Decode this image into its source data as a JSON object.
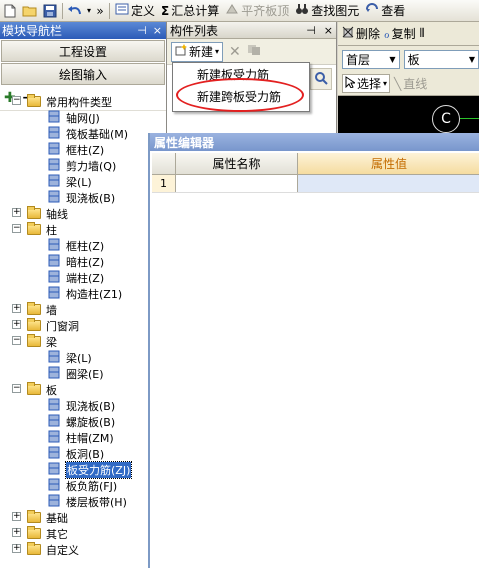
{
  "toolbar": {
    "icons": [
      "new-file-icon",
      "open-folder-icon",
      "save-icon",
      "undo-icon",
      "more-chevron-icon"
    ],
    "more": "»",
    "items": [
      {
        "label": "定义",
        "icon": "define-icon",
        "enabled": true
      },
      {
        "label": "汇总计算",
        "icon": "sigma-icon",
        "enabled": true
      },
      {
        "label": "平齐板顶",
        "icon": "flat-top-icon",
        "enabled": false
      },
      {
        "label": "查找图元",
        "icon": "binoculars-icon",
        "enabled": true
      },
      {
        "label": "查看",
        "icon": "view-icon",
        "enabled": true
      }
    ]
  },
  "nav": {
    "title": "模块导航栏",
    "pin": "4",
    "close": "×",
    "buttons": [
      "工程设置",
      "绘图输入"
    ],
    "tools": {
      "add": "+",
      "remove": "−"
    }
  },
  "tree": [
    {
      "label": "常用构件类型",
      "level": 0,
      "expanded": true,
      "folder": true
    },
    {
      "label": "轴网(J)",
      "level": 1,
      "icon": "grid-icon"
    },
    {
      "label": "筏板基础(M)",
      "level": 1,
      "icon": "raft-foundation-icon"
    },
    {
      "label": "框柱(Z)",
      "level": 1,
      "icon": "column-icon"
    },
    {
      "label": "剪力墙(Q)",
      "level": 1,
      "icon": "shear-wall-icon"
    },
    {
      "label": "梁(L)",
      "level": 1,
      "icon": "beam-icon"
    },
    {
      "label": "现浇板(B)",
      "level": 1,
      "icon": "cast-slab-icon"
    },
    {
      "label": "轴线",
      "level": 0,
      "expanded": false,
      "folder": true
    },
    {
      "label": "柱",
      "level": 0,
      "expanded": true,
      "folder": true
    },
    {
      "label": "框柱(Z)",
      "level": 1,
      "icon": "column-icon"
    },
    {
      "label": "暗柱(Z)",
      "level": 1,
      "icon": "hidden-column-icon"
    },
    {
      "label": "端柱(Z)",
      "level": 1,
      "icon": "end-column-icon"
    },
    {
      "label": "构造柱(Z1)",
      "level": 1,
      "icon": "constructional-column-icon"
    },
    {
      "label": "墙",
      "level": 0,
      "expanded": false,
      "folder": true
    },
    {
      "label": "门窗洞",
      "level": 0,
      "expanded": false,
      "folder": true
    },
    {
      "label": "梁",
      "level": 0,
      "expanded": true,
      "folder": true
    },
    {
      "label": "梁(L)",
      "level": 1,
      "icon": "beam-icon"
    },
    {
      "label": "圈梁(E)",
      "level": 1,
      "icon": "ring-beam-icon"
    },
    {
      "label": "板",
      "level": 0,
      "expanded": true,
      "folder": true
    },
    {
      "label": "现浇板(B)",
      "level": 1,
      "icon": "cast-slab-icon"
    },
    {
      "label": "螺旋板(B)",
      "level": 1,
      "icon": "spiral-slab-icon"
    },
    {
      "label": "柱帽(ZM)",
      "level": 1,
      "icon": "column-cap-icon"
    },
    {
      "label": "板洞(B)",
      "level": 1,
      "icon": "slab-hole-icon"
    },
    {
      "label": "板受力筋(ZJ)",
      "level": 1,
      "icon": "slab-rebar-icon",
      "selected": true
    },
    {
      "label": "板负筋(FJ)",
      "level": 1,
      "icon": "negative-rebar-icon"
    },
    {
      "label": "楼层板带(H)",
      "level": 1,
      "icon": "floor-strip-icon"
    },
    {
      "label": "基础",
      "level": 0,
      "expanded": false,
      "folder": true
    },
    {
      "label": "其它",
      "level": 0,
      "expanded": false,
      "folder": true
    },
    {
      "label": "自定义",
      "level": 0,
      "expanded": false,
      "folder": true
    }
  ],
  "clist": {
    "title": "构件列表",
    "pin": "4",
    "close": "×",
    "new_label": "新建",
    "delete_icon": "delete-icon",
    "copy_icon": "copy-icon"
  },
  "new_menu": {
    "items": [
      "新建板受力筋",
      "新建跨板受力筋"
    ],
    "highlighted_index": 1,
    "highlight_color": "#e32020"
  },
  "right_toolbar": {
    "delete_label": "删除",
    "copy_label": "复制",
    "floor_value": "首层",
    "type_value": "板",
    "select_label": "选择",
    "line_label": "直线"
  },
  "canvas": {
    "axis_label": "C"
  },
  "property_editor": {
    "title": "属性编辑器",
    "col_name": "属性名称",
    "col_value": "属性值",
    "rows": [
      {
        "index": "1",
        "name": "",
        "value": ""
      }
    ],
    "value_header_color": "#c46c00",
    "value_cell_color": "#dfe8f7"
  }
}
